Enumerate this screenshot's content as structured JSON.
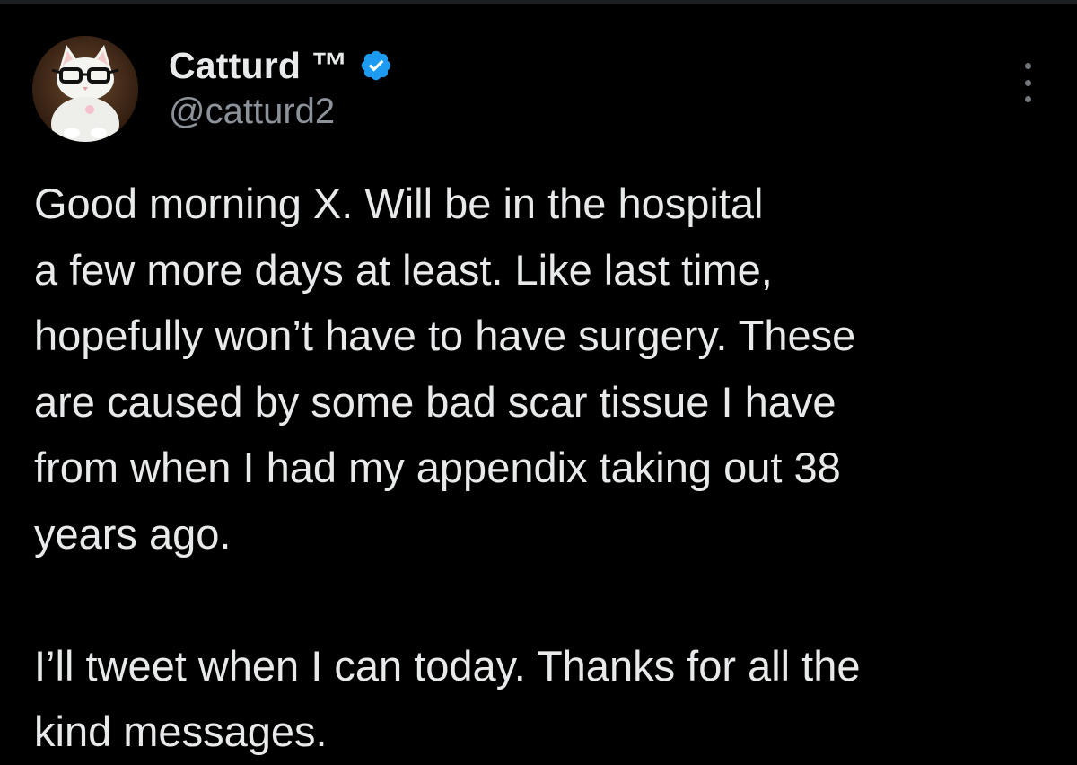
{
  "author": {
    "display_name": "Catturd ™",
    "handle": "@catturd2",
    "verified": true,
    "avatar_icon": "cat-with-glasses-avatar"
  },
  "menu": {
    "icon": "more-options-icon"
  },
  "tweet": {
    "paragraphs": [
      {
        "lines": [
          "Good morning X. Will be in the hospital",
          "a few more days at least. Like last time,",
          "hopefully won’t have to have surgery. These",
          "are caused by some bad scar tissue I have",
          "from when I had my appendix taking out 38",
          "years ago."
        ]
      },
      {
        "lines": [
          "I’ll tweet when I can today. Thanks for all the",
          "kind messages."
        ]
      }
    ]
  },
  "colors": {
    "background": "#000000",
    "text": "#e7e9ea",
    "secondary": "#8b9299",
    "verified_badge": "#1d9bf0"
  }
}
